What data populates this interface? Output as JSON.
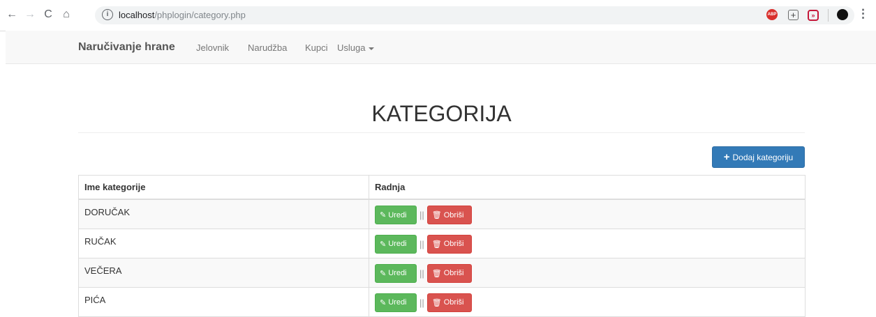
{
  "browser": {
    "url_host": "localhost",
    "url_path": "/phplogin/category.php",
    "extensions": [
      "adblock-plus-icon",
      "plus-box-icon",
      "red-square-icon",
      "dark-circle-icon"
    ]
  },
  "navbar": {
    "brand": "Naručivanje hrane",
    "links": [
      "Jelovnik",
      "Narudžba",
      "Kupci",
      "Usluga"
    ]
  },
  "page": {
    "title": "KATEGORIJA",
    "add_button": "Dodaj kategoriju"
  },
  "table": {
    "headers": [
      "Ime kategorije",
      "Radnja"
    ],
    "rows": [
      "DORUČAK",
      "RUČAK",
      "VEČERA",
      "PIĆA"
    ],
    "edit_label": "Uredi",
    "delete_label": "Obriši",
    "separator": "||"
  },
  "colors": {
    "primary": "#337ab7",
    "success": "#5cb85c",
    "danger": "#d9534f"
  }
}
